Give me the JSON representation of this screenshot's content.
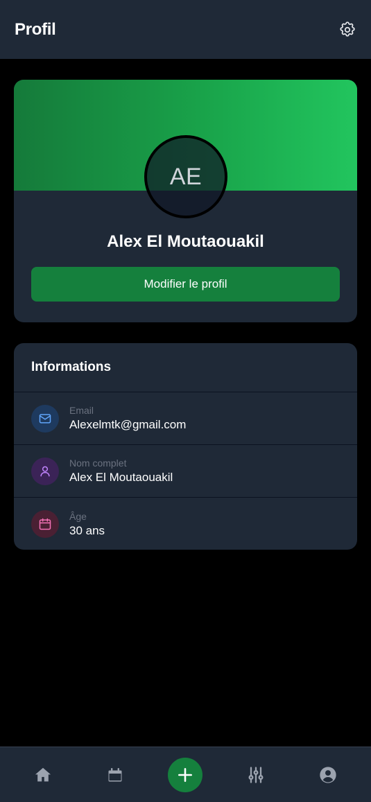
{
  "header": {
    "title": "Profil",
    "settings_icon": "gear-icon"
  },
  "profile": {
    "initials": "AE",
    "name": "Alex El Moutaouakil",
    "edit_label": "Modifier le profil",
    "banner_colors": [
      "#157a3a",
      "#22c55e"
    ]
  },
  "info": {
    "title": "Informations",
    "rows": [
      {
        "label": "Email",
        "value": "Alexelmtk@gmail.com",
        "icon": "mail-icon",
        "color": "#60a5fa"
      },
      {
        "label": "Nom complet",
        "value": "Alex El Moutaouakil",
        "icon": "user-icon",
        "color": "#c084fc"
      },
      {
        "label": "Âge",
        "value": "30 ans",
        "icon": "calendar-icon",
        "color": "#f472b6"
      }
    ]
  },
  "nav": {
    "items": [
      "home-icon",
      "calendar-icon",
      "add-icon",
      "sliders-icon",
      "account-icon"
    ],
    "accent": "#15803d"
  }
}
